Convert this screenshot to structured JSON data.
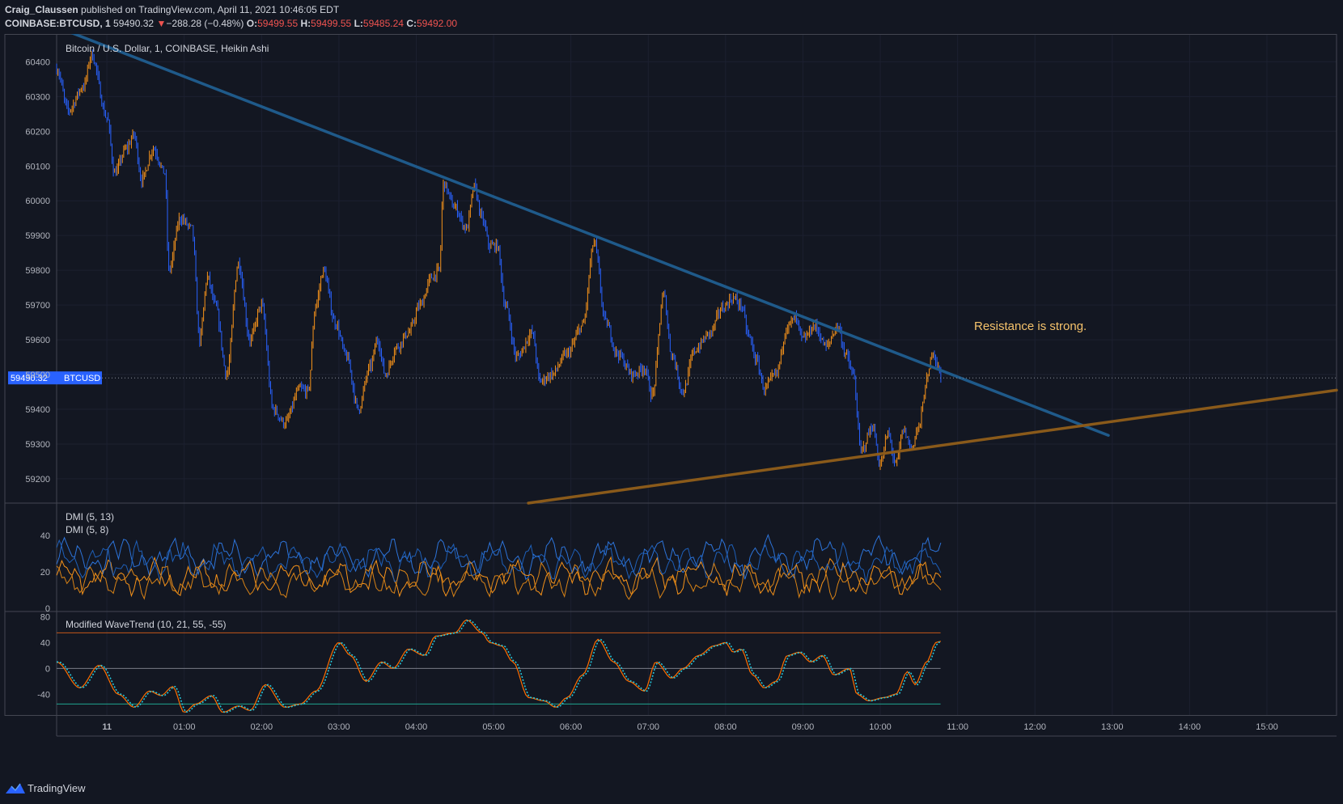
{
  "header": {
    "author": "Craig_Claussen",
    "published_text": "published on TradingView.com, April 11, 2021 10:46:05 EDT",
    "symbol": "COINBASE:BTCUSD, 1",
    "last_price": "59490.32",
    "change": "−288.28 (−0.48%)",
    "o_label": "O:",
    "o_value": "59499.55",
    "h_label": "H:",
    "h_value": "59499.55",
    "l_label": "L:",
    "l_value": "59485.24",
    "c_label": "C:",
    "c_value": "59492.00",
    "down_arrow": "▼"
  },
  "footer": {
    "brand": "TradingView",
    "logo_icon": "tradingview-logo-icon"
  },
  "colors": {
    "background": "#131722",
    "up": "#f7931a",
    "down": "#2962ff",
    "resistance": "#1f5a8a",
    "support": "#8a5a1a",
    "annotation": "#f5c26b",
    "wt1": "#ff6d00",
    "wt2": "#26c6da"
  },
  "chart_data": [
    {
      "type": "candlestick",
      "title": "Bitcoin / U.S. Dollar, 1, COINBASE, Heikin Ashi",
      "price_label": "59490.32",
      "symbol_label": "BTCUSD",
      "annotation": "Resistance is strong.",
      "ylim": [
        59130,
        60480
      ],
      "yticks": [
        59200,
        59300,
        59400,
        59500,
        59600,
        59700,
        59800,
        59900,
        60000,
        60100,
        60200,
        60300,
        60400
      ],
      "xlim": [
        -0.65,
        15.9
      ],
      "xtick_labels": [
        "11",
        "01:00",
        "02:00",
        "03:00",
        "04:00",
        "05:00",
        "06:00",
        "07:00",
        "08:00",
        "09:00",
        "10:00",
        "11:00",
        "12:00",
        "13:00",
        "14:00",
        "15:00"
      ],
      "price_anchors": [
        [
          -0.65,
          60380
        ],
        [
          -0.5,
          60260
        ],
        [
          -0.3,
          60330
        ],
        [
          -0.2,
          60420
        ],
        [
          0,
          60240
        ],
        [
          0.1,
          60080
        ],
        [
          0.25,
          60150
        ],
        [
          0.35,
          60190
        ],
        [
          0.45,
          60060
        ],
        [
          0.6,
          60150
        ],
        [
          0.75,
          60080
        ],
        [
          0.8,
          59800
        ],
        [
          0.95,
          59950
        ],
        [
          1.1,
          59920
        ],
        [
          1.2,
          59600
        ],
        [
          1.3,
          59780
        ],
        [
          1.4,
          59700
        ],
        [
          1.55,
          59500
        ],
        [
          1.7,
          59820
        ],
        [
          1.85,
          59600
        ],
        [
          2.0,
          59700
        ],
        [
          2.15,
          59400
        ],
        [
          2.3,
          59360
        ],
        [
          2.5,
          59460
        ],
        [
          2.6,
          59450
        ],
        [
          2.7,
          59700
        ],
        [
          2.8,
          59800
        ],
        [
          2.95,
          59650
        ],
        [
          3.1,
          59550
        ],
        [
          3.25,
          59400
        ],
        [
          3.4,
          59520
        ],
        [
          3.5,
          59600
        ],
        [
          3.6,
          59500
        ],
        [
          3.75,
          59580
        ],
        [
          3.9,
          59620
        ],
        [
          4.05,
          59700
        ],
        [
          4.2,
          59780
        ],
        [
          4.3,
          59800
        ],
        [
          4.35,
          60050
        ],
        [
          4.5,
          59980
        ],
        [
          4.65,
          59920
        ],
        [
          4.75,
          60040
        ],
        [
          4.85,
          59950
        ],
        [
          4.95,
          59870
        ],
        [
          5.05,
          59870
        ],
        [
          5.15,
          59700
        ],
        [
          5.3,
          59550
        ],
        [
          5.5,
          59620
        ],
        [
          5.6,
          59480
        ],
        [
          5.75,
          59500
        ],
        [
          5.95,
          59560
        ],
        [
          6.15,
          59640
        ],
        [
          6.3,
          59880
        ],
        [
          6.45,
          59650
        ],
        [
          6.6,
          59560
        ],
        [
          6.8,
          59500
        ],
        [
          6.95,
          59520
        ],
        [
          7.05,
          59440
        ],
        [
          7.2,
          59730
        ],
        [
          7.3,
          59560
        ],
        [
          7.45,
          59450
        ],
        [
          7.6,
          59570
        ],
        [
          7.8,
          59620
        ],
        [
          7.95,
          59690
        ],
        [
          8.1,
          59720
        ],
        [
          8.2,
          59700
        ],
        [
          8.3,
          59610
        ],
        [
          8.4,
          59540
        ],
        [
          8.5,
          59460
        ],
        [
          8.65,
          59500
        ],
        [
          8.8,
          59640
        ],
        [
          8.9,
          59660
        ],
        [
          9.0,
          59600
        ],
        [
          9.15,
          59640
        ],
        [
          9.3,
          59580
        ],
        [
          9.45,
          59640
        ],
        [
          9.55,
          59560
        ],
        [
          9.65,
          59500
        ],
        [
          9.75,
          59280
        ],
        [
          9.9,
          59350
        ],
        [
          10.0,
          59240
        ],
        [
          10.1,
          59330
        ],
        [
          10.2,
          59240
        ],
        [
          10.3,
          59340
        ],
        [
          10.4,
          59290
        ],
        [
          10.5,
          59350
        ],
        [
          10.6,
          59480
        ],
        [
          10.68,
          59570
        ],
        [
          10.75,
          59520
        ],
        [
          10.78,
          59490
        ]
      ],
      "resistance_line": {
        "from": [
          -0.65,
          60500
        ],
        "to": [
          12.95,
          59325
        ],
        "label": ""
      },
      "support_line": {
        "from": [
          5.45,
          59130
        ],
        "to": [
          15.9,
          59455
        ],
        "label": ""
      }
    },
    {
      "type": "line",
      "title": "DMI (5, 13)",
      "subtitle": "DMI (5, 8)",
      "ylim": [
        0,
        56
      ],
      "yticks": [
        0,
        20,
        40
      ],
      "series": [
        {
          "name": "",
          "color": "#2d74da",
          "base": 28,
          "amplitude": 10
        },
        {
          "name": "",
          "color": "#f7931a",
          "base": 17,
          "amplitude": 9
        },
        {
          "name": "",
          "color": "#1e5fb8",
          "base": 26,
          "amplitude": 9
        },
        {
          "name": "",
          "color": "#d98316",
          "base": 15,
          "amplitude": 8
        }
      ]
    },
    {
      "type": "line",
      "title": "Modified WaveTrend (10, 21, 55, -55)",
      "ylim": [
        -72,
        88
      ],
      "yticks": [
        -40,
        0,
        40,
        80
      ],
      "levels": [
        {
          "value": 55,
          "color": "#c2571a"
        },
        {
          "value": 0,
          "color": "#787b86"
        },
        {
          "value": -55,
          "color": "#1fa58f"
        }
      ],
      "wave_anchors": [
        [
          -0.65,
          10
        ],
        [
          -0.35,
          -30
        ],
        [
          -0.1,
          5
        ],
        [
          0.15,
          -40
        ],
        [
          0.35,
          -60
        ],
        [
          0.55,
          -35
        ],
        [
          0.7,
          -42
        ],
        [
          0.85,
          -28
        ],
        [
          1.0,
          -68
        ],
        [
          1.15,
          -55
        ],
        [
          1.35,
          -42
        ],
        [
          1.5,
          -68
        ],
        [
          1.7,
          -58
        ],
        [
          1.85,
          -65
        ],
        [
          2.05,
          -25
        ],
        [
          2.3,
          -60
        ],
        [
          2.5,
          -55
        ],
        [
          2.7,
          -35
        ],
        [
          3.0,
          40
        ],
        [
          3.15,
          20
        ],
        [
          3.35,
          -20
        ],
        [
          3.55,
          10
        ],
        [
          3.7,
          0
        ],
        [
          3.9,
          30
        ],
        [
          4.1,
          20
        ],
        [
          4.25,
          50
        ],
        [
          4.5,
          55
        ],
        [
          4.65,
          75
        ],
        [
          4.85,
          55
        ],
        [
          4.95,
          40
        ],
        [
          5.1,
          35
        ],
        [
          5.25,
          10
        ],
        [
          5.45,
          -45
        ],
        [
          5.65,
          -50
        ],
        [
          5.8,
          -60
        ],
        [
          5.95,
          -45
        ],
        [
          6.15,
          -10
        ],
        [
          6.35,
          45
        ],
        [
          6.55,
          10
        ],
        [
          6.75,
          -20
        ],
        [
          6.95,
          -35
        ],
        [
          7.1,
          10
        ],
        [
          7.3,
          -15
        ],
        [
          7.45,
          0
        ],
        [
          7.65,
          20
        ],
        [
          7.85,
          35
        ],
        [
          8.0,
          40
        ],
        [
          8.1,
          25
        ],
        [
          8.2,
          30
        ],
        [
          8.35,
          -10
        ],
        [
          8.5,
          -30
        ],
        [
          8.65,
          -20
        ],
        [
          8.8,
          20
        ],
        [
          8.95,
          25
        ],
        [
          9.1,
          10
        ],
        [
          9.25,
          20
        ],
        [
          9.4,
          -10
        ],
        [
          9.6,
          0
        ],
        [
          9.7,
          -40
        ],
        [
          9.85,
          -50
        ],
        [
          10.05,
          -45
        ],
        [
          10.2,
          -40
        ],
        [
          10.35,
          -5
        ],
        [
          10.45,
          -25
        ],
        [
          10.6,
          10
        ],
        [
          10.72,
          40
        ],
        [
          10.78,
          42
        ]
      ]
    }
  ]
}
